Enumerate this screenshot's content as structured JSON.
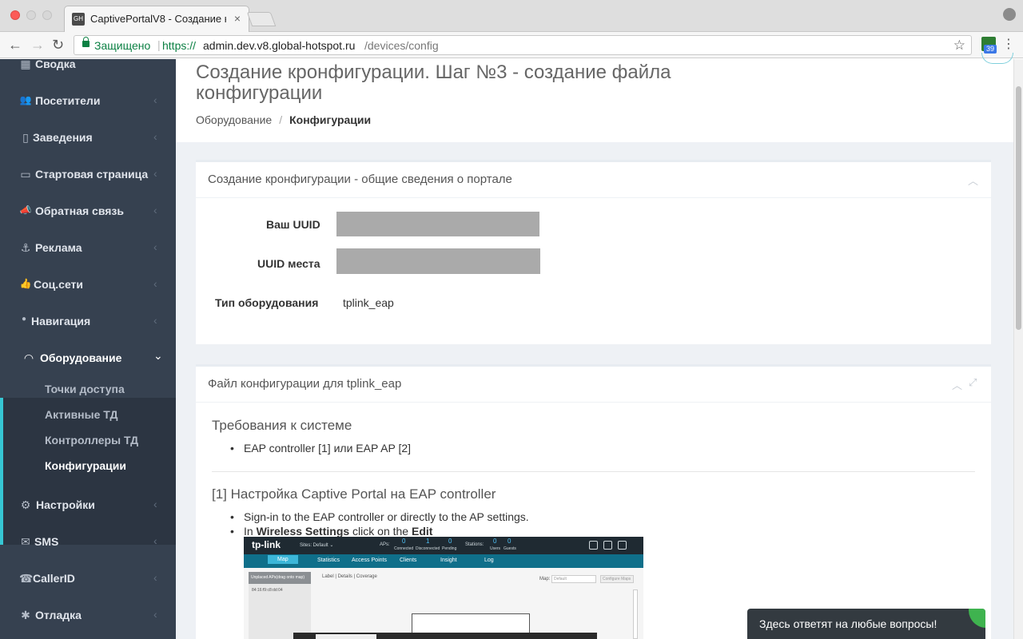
{
  "browser": {
    "tab_title": "CaptivePortalV8 - Создание к",
    "tab_close": "×",
    "favicon_text": "GH",
    "secure_label": "Защищено",
    "url_scheme": "https://",
    "url_host": "admin.dev.v8.global-hotspot.ru",
    "url_path": "/devices/config",
    "extension_badge": "39",
    "icons": [
      "back-icon",
      "forward-icon",
      "reload-icon",
      "lock-icon",
      "star-icon",
      "menu-icon",
      "profile-icon"
    ]
  },
  "sidebar": {
    "items": [
      {
        "label": "Сводка",
        "icon": "▦"
      },
      {
        "label": "Посетители",
        "icon": "👥",
        "arrow": "‹"
      },
      {
        "label": "Заведения",
        "icon": "▯",
        "arrow": "‹"
      },
      {
        "label": "Стартовая страница",
        "icon": "▭",
        "arrow": "‹"
      },
      {
        "label": "Обратная связь",
        "icon": "📣",
        "arrow": "‹"
      },
      {
        "label": "Реклама",
        "icon": "⚓",
        "arrow": "‹"
      },
      {
        "label": "Соц.сети",
        "icon": "👍",
        "arrow": "‹"
      },
      {
        "label": "Навигация",
        "icon": "●",
        "arrow": "‹"
      },
      {
        "label": "Оборудование",
        "icon": "◠",
        "arrow": "⌄"
      },
      {
        "label": "Настройки",
        "icon": "⚙",
        "arrow": "‹"
      },
      {
        "label": "SMS",
        "icon": "✉",
        "arrow": "‹"
      },
      {
        "label": "CallerID",
        "icon": "☎",
        "arrow": "‹"
      },
      {
        "label": "Отладка",
        "icon": "✱",
        "arrow": "‹"
      }
    ],
    "submenu": [
      {
        "label": "Точки доступа"
      },
      {
        "label": "Активные ТД"
      },
      {
        "label": "Контроллеры ТД"
      },
      {
        "label": "Конфигурации"
      }
    ],
    "colors": {
      "background": "#364150",
      "open_background": "#2c3542",
      "accent": "#36c6d3"
    }
  },
  "page": {
    "title": "Создание кронфигурации. Шаг №3 - создание файла конфигурации",
    "breadcrumb": {
      "parent": "Оборудование",
      "separator": "/",
      "current": "Конфигурации"
    }
  },
  "portlet_general": {
    "title": "Создание кронфигурации - общие сведения о портале",
    "fields": {
      "uuid_label": "Ваш UUID",
      "place_uuid_label": "UUID места",
      "equipment_type_label": "Тип оборудования",
      "equipment_type_value": "tplink_eap"
    },
    "collapse_icon": "︿"
  },
  "portlet_file": {
    "title": "Файл конфигурации для tplink_eap",
    "collapse_icon": "︿",
    "expand_icon": "⤢",
    "requirements_title": "Требования к системе",
    "requirements": [
      "EAP controller [1] или EAP AP [2]"
    ],
    "section1_title": "[1] Настройка Captive Portal на EAP controller",
    "section1_steps": {
      "step1": "Sign-in to the EAP controller or directly to the AP settings.",
      "step2_prefix": "In ",
      "step2_bold1": "Wireless Settings",
      "step2_middle": " click on the ",
      "step2_bold2": "Edit"
    }
  },
  "tplink_screenshot": {
    "logo": "tp-link",
    "sites_label": "Sites: Default ⌄",
    "aps_label": "APs:",
    "counts": [
      "0",
      "1",
      "0"
    ],
    "count_labels": [
      "Connected",
      "Disconnected",
      "Pending"
    ],
    "stations_label": "Stations:",
    "station_counts": [
      "0",
      "0"
    ],
    "station_labels": [
      "Users",
      "Guests"
    ],
    "tabs": [
      "Map",
      "Statistics",
      "Access Points",
      "Clients",
      "Insight",
      "Log"
    ],
    "side_header": "Unplaced APs(drag onto map)",
    "mac": "84:16:f9:c8:dd:04",
    "links": "Label | Details | Coverage",
    "map_label": "Map:",
    "map_select": "Default",
    "configure_button": "Configure Maps"
  },
  "chat": {
    "text": "Здесь ответят на любые вопросы!"
  }
}
